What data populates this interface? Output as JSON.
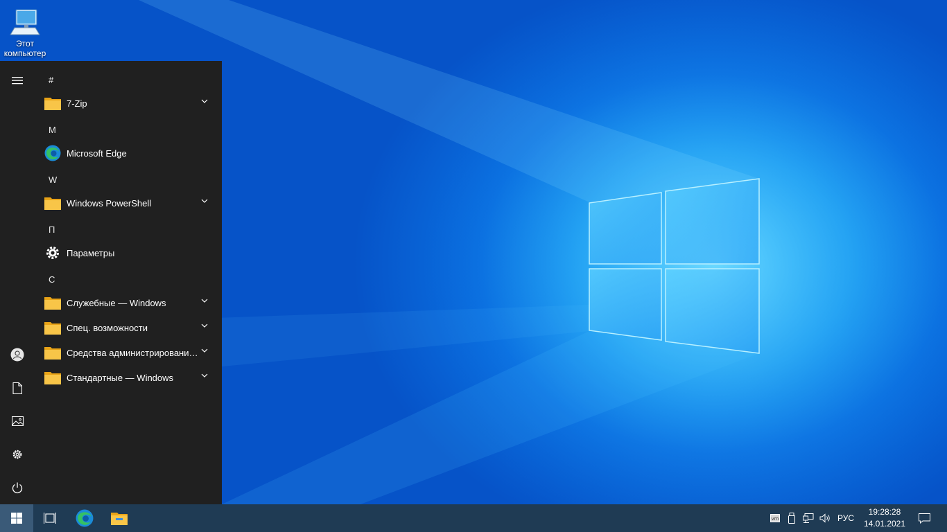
{
  "desktop": {
    "icons": [
      {
        "label_line1": "Этот",
        "label_line2": "компьютер",
        "icon": "computer-icon"
      }
    ]
  },
  "start_menu": {
    "rail": [
      {
        "icon": "hamburger-menu-icon"
      },
      {
        "icon": "user-account-icon"
      },
      {
        "icon": "documents-icon"
      },
      {
        "icon": "pictures-icon"
      },
      {
        "icon": "settings-gear-icon"
      },
      {
        "icon": "power-icon"
      }
    ],
    "groups": [
      {
        "letter": "#",
        "apps": [
          {
            "label": "7-Zip",
            "icon": "folder-icon",
            "expandable": true
          }
        ]
      },
      {
        "letter": "M",
        "apps": [
          {
            "label": "Microsoft Edge",
            "icon": "edge-icon",
            "expandable": false
          }
        ]
      },
      {
        "letter": "W",
        "apps": [
          {
            "label": "Windows PowerShell",
            "icon": "folder-icon",
            "expandable": true
          }
        ]
      },
      {
        "letter": "П",
        "apps": [
          {
            "label": "Параметры",
            "icon": "settings-gear-icon",
            "expandable": false
          }
        ]
      },
      {
        "letter": "С",
        "apps": [
          {
            "label": "Служебные — Windows",
            "icon": "folder-icon",
            "expandable": true
          },
          {
            "label": "Спец. возможности",
            "icon": "folder-icon",
            "expandable": true
          },
          {
            "label": "Средства администрирования W...",
            "icon": "folder-icon",
            "expandable": true
          },
          {
            "label": "Стандартные — Windows",
            "icon": "folder-icon",
            "expandable": true
          }
        ]
      }
    ]
  },
  "taskbar": {
    "buttons": [
      {
        "icon": "windows-start-icon"
      },
      {
        "icon": "task-view-icon"
      },
      {
        "icon": "edge-icon"
      },
      {
        "icon": "file-explorer-icon"
      }
    ],
    "tray": {
      "icons": [
        "vmware-tools-icon",
        "usb-device-icon",
        "network-icon",
        "volume-icon"
      ],
      "language": "РУС",
      "time": "19:28:28",
      "date": "14.01.2021",
      "notification_icon": "action-center-icon"
    }
  },
  "colors": {
    "start_menu_bg": "#202020",
    "taskbar_bg": "#1f3b54",
    "folder_yellow": "#f8c548",
    "wallpaper_blue": "#0a6fe0"
  }
}
